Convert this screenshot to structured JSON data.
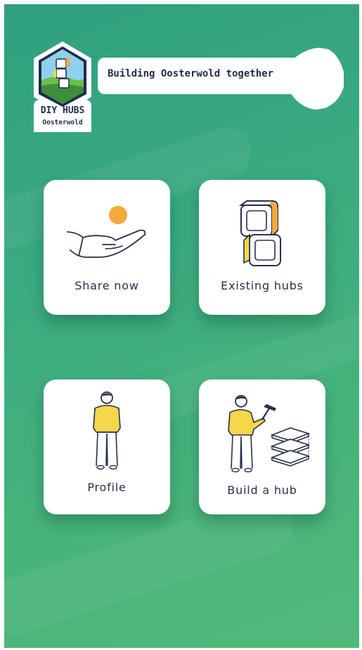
{
  "app": {
    "logo_title": "DIY HUBS",
    "logo_subtitle": "Oosterwold",
    "tagline": "Building Oosterwold together"
  },
  "menu": [
    {
      "label": "Share now",
      "icon": "hand-sun-icon"
    },
    {
      "label": "Existing hubs",
      "icon": "hub-blocks-icon"
    },
    {
      "label": "Profile",
      "icon": "person-icon"
    },
    {
      "label": "Build a hub",
      "icon": "builder-icon"
    }
  ],
  "colors": {
    "bg_top": "#2fa07f",
    "bg_bottom": "#52b97a",
    "card": "#ffffff",
    "text": "#26304a",
    "accent_yellow": "#f6d64a",
    "accent_orange": "#f7a93b"
  }
}
